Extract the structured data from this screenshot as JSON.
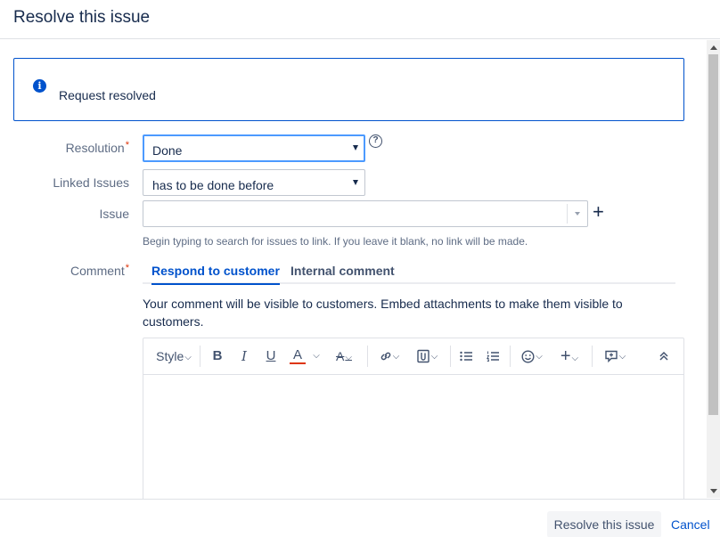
{
  "dialog": {
    "title": "Resolve this issue"
  },
  "message": {
    "icon": "info-icon",
    "text": "Request resolved"
  },
  "form": {
    "resolution": {
      "label": "Resolution",
      "required_marker": "*",
      "value": "Done"
    },
    "linked_issues": {
      "label": "Linked Issues",
      "value": "has to be done before"
    },
    "issue": {
      "label": "Issue",
      "value": "",
      "hint": "Begin typing to search for issues to link. If you leave it blank, no link will be made."
    },
    "comment": {
      "label": "Comment",
      "required_marker": "*",
      "tabs": [
        {
          "label": "Respond to customer",
          "active": true
        },
        {
          "label": "Internal comment",
          "active": false
        }
      ],
      "visibility_note": "Your comment will be visible to customers. Embed attachments to make them visible to customers."
    }
  },
  "toolbar": {
    "style_label": "Style",
    "bold": "B",
    "italic": "I",
    "underline": "U",
    "text_color": "A",
    "more_format": "A",
    "link_icon": "link-icon",
    "attach_icon": "attachment-icon",
    "bullet_icon": "bullet-list-icon",
    "number_icon": "numbered-list-icon",
    "emoji_icon": "emoji-icon",
    "insert_icon": "plus-icon",
    "macro_icon": "macro-icon",
    "collapse_icon": "collapse-icon",
    "accent_color": "#de350b"
  },
  "footer": {
    "resolve_label": "Resolve this issue",
    "cancel_label": "Cancel"
  }
}
